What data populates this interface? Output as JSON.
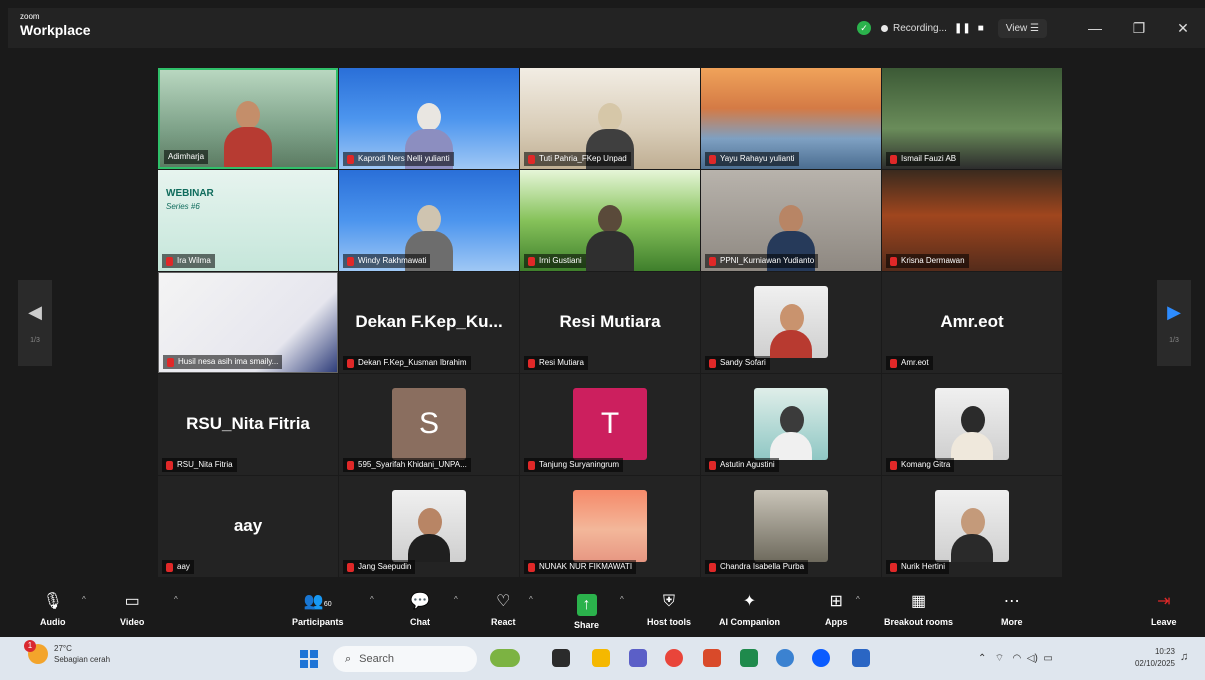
{
  "app": {
    "brand_small": "zoom",
    "brand_big": "Workplace"
  },
  "titlebar": {
    "recording_label": "Recording...",
    "pause_icon": "pause-icon",
    "stop_icon": "stop-icon",
    "view_label": "View",
    "window_controls": [
      "minimize-icon",
      "restore-icon",
      "close-icon"
    ]
  },
  "stage": {
    "page_left": "1/3",
    "page_right": "1/3"
  },
  "tiles": [
    {
      "name": "Adimharja",
      "type": "video"
    },
    {
      "name": "Kaprodi Ners Nelli yulianti",
      "type": "video"
    },
    {
      "name": "Tuti Pahria_FKep Unpad",
      "type": "video"
    },
    {
      "name": "Yayu Rahayu yulianti",
      "type": "video"
    },
    {
      "name": "Ismail Fauzi AB",
      "type": "video"
    },
    {
      "name": "Ira Wilma",
      "type": "video",
      "slide_title": "WEBINAR",
      "slide_sub": "Series #6"
    },
    {
      "name": "Windy Rakhmawati",
      "type": "video"
    },
    {
      "name": "Irni Gustiani",
      "type": "video"
    },
    {
      "name": "PPNI_Kurniawan Yudianto",
      "type": "video"
    },
    {
      "name": "Krisna Dermawan",
      "type": "video"
    },
    {
      "name": "Husil nesa asih ima smaily...",
      "type": "video"
    },
    {
      "name": "Dekan F.Kep_Kusman Ibrahim",
      "type": "name",
      "display": "Dekan  F.Kep_Ku..."
    },
    {
      "name": "Resi Mutiara",
      "type": "name",
      "display": "Resi Mutiara"
    },
    {
      "name": "Sandy Sofari",
      "type": "photo"
    },
    {
      "name": "Amr.eot",
      "type": "name",
      "display": "Amr.eot"
    },
    {
      "name": "RSU_Nita Fitria",
      "type": "name",
      "display": "RSU_Nita Fitria"
    },
    {
      "name": "595_Syarifah Khidani_UNPA...",
      "type": "letter",
      "letter": "S",
      "color": "#8a6e5f"
    },
    {
      "name": "Tanjung Suryaningrum",
      "type": "letter",
      "letter": "T",
      "color": "#cc1f5e"
    },
    {
      "name": "Astutin Agustini",
      "type": "photo"
    },
    {
      "name": "Komang Gitra",
      "type": "photo"
    },
    {
      "name": "aay",
      "type": "name",
      "display": "aay"
    },
    {
      "name": "Jang Saepudin",
      "type": "photo"
    },
    {
      "name": "NUNAK NUR FIKMAWATI",
      "type": "photo"
    },
    {
      "name": "Chandra Isabella Purba",
      "type": "photo"
    },
    {
      "name": "Nurik Hertini",
      "type": "photo"
    }
  ],
  "toolbar": {
    "audio": "Audio",
    "video": "Video",
    "participants": "Participants",
    "participants_count": "60",
    "chat": "Chat",
    "react": "React",
    "share": "Share",
    "host_tools": "Host tools",
    "ai_companion": "AI Companion",
    "apps": "Apps",
    "breakout_rooms": "Breakout rooms",
    "more": "More",
    "leave": "Leave"
  },
  "taskbar": {
    "weather_temp": "27°C",
    "weather_desc": "Sebagian cerah",
    "weather_badge": "1",
    "search_placeholder": "Search",
    "time": "10:23",
    "date": "02/10/2025"
  },
  "colors": {
    "active_speaker": "#30c06a",
    "share_green": "#2bb24c",
    "muted_red": "#e02828",
    "nav_blue": "#2d8cff"
  }
}
